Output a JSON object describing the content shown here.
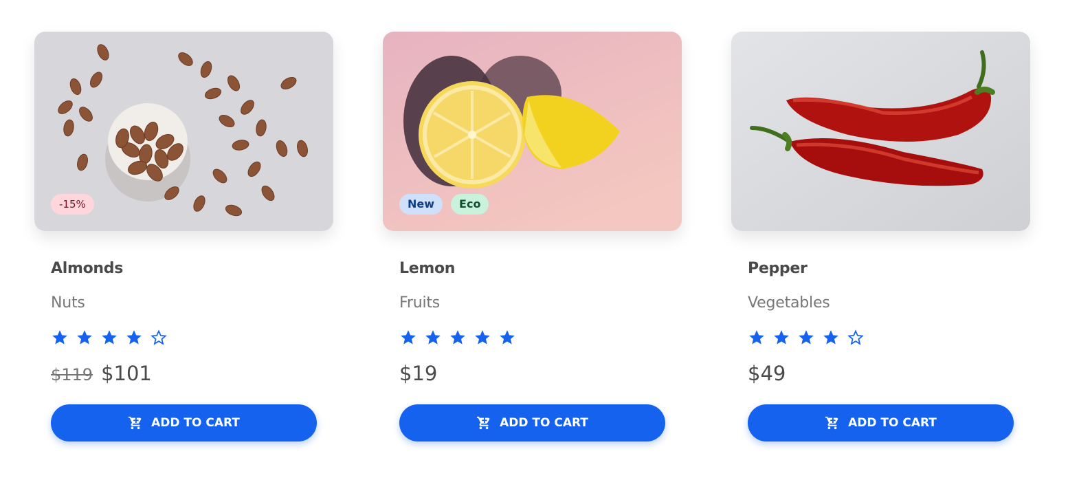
{
  "products": [
    {
      "name": "Almonds",
      "category": "Nuts",
      "rating": 4,
      "max_rating": 5,
      "old_price": "$119",
      "price": "$101",
      "badges": [
        "-15%"
      ],
      "button_label": "ADD TO CART",
      "image_subject": "almonds"
    },
    {
      "name": "Lemon",
      "category": "Fruits",
      "rating": 5,
      "max_rating": 5,
      "old_price": "",
      "price": "$19",
      "badges": [
        "New",
        "Eco"
      ],
      "button_label": "ADD TO CART",
      "image_subject": "lemon"
    },
    {
      "name": "Pepper",
      "category": "Vegetables",
      "rating": 4,
      "max_rating": 5,
      "old_price": "",
      "price": "$49",
      "badges": [],
      "button_label": "ADD TO CART",
      "image_subject": "pepper"
    }
  ],
  "colors": {
    "accent": "#1562ef",
    "star": "#1562ef",
    "text": "#4a4a4a",
    "muted": "#777777"
  },
  "icons": {
    "cart": "cart-plus-icon",
    "star_filled": "star-filled-icon",
    "star_empty": "star-outline-icon"
  }
}
